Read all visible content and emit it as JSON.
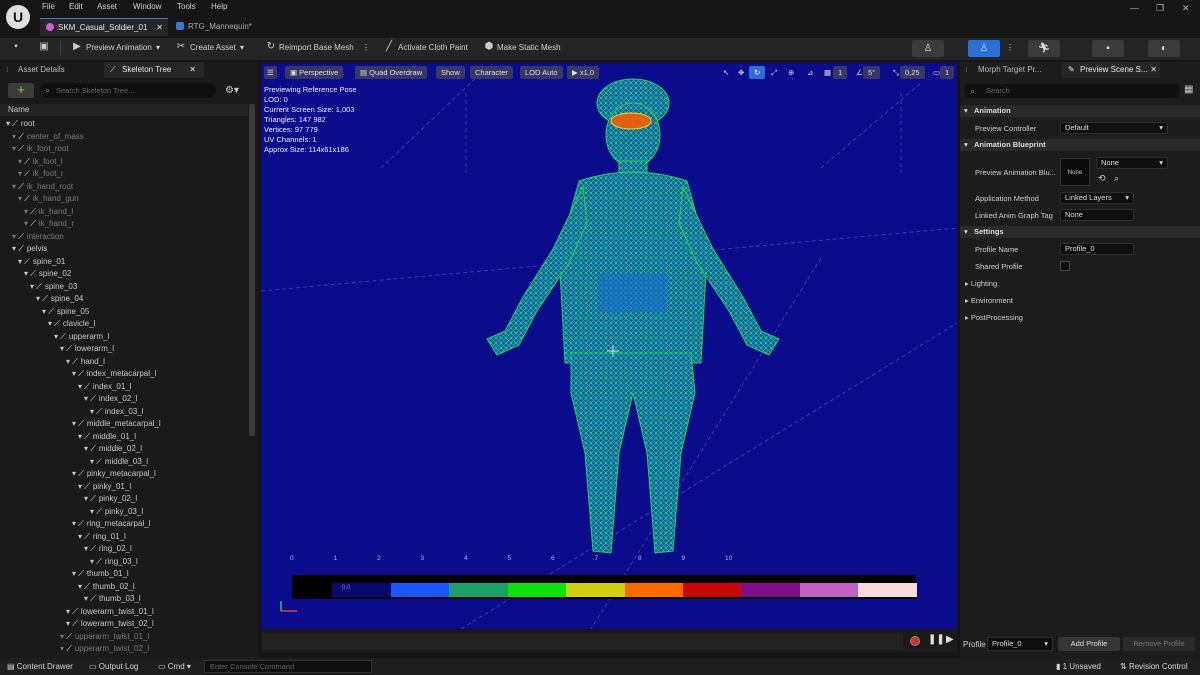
{
  "app": {
    "logo": "U",
    "menu": [
      "File",
      "Edit",
      "Asset",
      "Window",
      "Tools",
      "Help"
    ],
    "tabs": [
      "SKM_Casual_Soldier_01",
      "RTG_Mannequin*"
    ]
  },
  "toolbar": {
    "save_icon": "save-icon",
    "preview_animation": "Preview Animation",
    "create_asset": "Create Asset",
    "reimport": "Reimport Base Mesh",
    "activate_cloth": "Activate Cloth Paint",
    "make_static": "Make Static Mesh"
  },
  "left": {
    "tab_details": "Asset Details",
    "tab_skeleton": "Skeleton Tree",
    "search_placeholder": "Search Skeleton Tree...",
    "name_header": "Name",
    "tree": [
      {
        "label": "root",
        "depth": 0,
        "dim": false
      },
      {
        "label": "center_of_mass",
        "depth": 1,
        "dim": true
      },
      {
        "label": "ik_foot_root",
        "depth": 1,
        "dim": true
      },
      {
        "label": "ik_foot_l",
        "depth": 2,
        "dim": true
      },
      {
        "label": "ik_foot_r",
        "depth": 2,
        "dim": true
      },
      {
        "label": "ik_hand_root",
        "depth": 1,
        "dim": true
      },
      {
        "label": "ik_hand_gun",
        "depth": 2,
        "dim": true
      },
      {
        "label": "ik_hand_l",
        "depth": 3,
        "dim": true
      },
      {
        "label": "ik_hand_r",
        "depth": 3,
        "dim": true
      },
      {
        "label": "interaction",
        "depth": 1,
        "dim": true
      },
      {
        "label": "pelvis",
        "depth": 1,
        "dim": false
      },
      {
        "label": "spine_01",
        "depth": 2,
        "dim": false
      },
      {
        "label": "spine_02",
        "depth": 3,
        "dim": false
      },
      {
        "label": "spine_03",
        "depth": 4,
        "dim": false
      },
      {
        "label": "spine_04",
        "depth": 5,
        "dim": false
      },
      {
        "label": "spine_05",
        "depth": 6,
        "dim": false
      },
      {
        "label": "clavicle_l",
        "depth": 7,
        "dim": false
      },
      {
        "label": "upperarm_l",
        "depth": 8,
        "dim": false
      },
      {
        "label": "lowerarm_l",
        "depth": 9,
        "dim": false
      },
      {
        "label": "hand_l",
        "depth": 10,
        "dim": false
      },
      {
        "label": "index_metacarpal_l",
        "depth": 11,
        "dim": false
      },
      {
        "label": "index_01_l",
        "depth": 12,
        "dim": false
      },
      {
        "label": "index_02_l",
        "depth": 13,
        "dim": false
      },
      {
        "label": "index_03_l",
        "depth": 14,
        "dim": false
      },
      {
        "label": "middle_metacarpal_l",
        "depth": 11,
        "dim": false
      },
      {
        "label": "middle_01_l",
        "depth": 12,
        "dim": false
      },
      {
        "label": "middle_02_l",
        "depth": 13,
        "dim": false
      },
      {
        "label": "middle_03_l",
        "depth": 14,
        "dim": false
      },
      {
        "label": "pinky_metacarpal_l",
        "depth": 11,
        "dim": false
      },
      {
        "label": "pinky_01_l",
        "depth": 12,
        "dim": false
      },
      {
        "label": "pinky_02_l",
        "depth": 13,
        "dim": false
      },
      {
        "label": "pinky_03_l",
        "depth": 14,
        "dim": false
      },
      {
        "label": "ring_metacarpal_l",
        "depth": 11,
        "dim": false
      },
      {
        "label": "ring_01_l",
        "depth": 12,
        "dim": false
      },
      {
        "label": "ring_02_l",
        "depth": 13,
        "dim": false
      },
      {
        "label": "ring_03_l",
        "depth": 14,
        "dim": false
      },
      {
        "label": "thumb_01_l",
        "depth": 11,
        "dim": false
      },
      {
        "label": "thumb_02_l",
        "depth": 12,
        "dim": false
      },
      {
        "label": "thumb_03_l",
        "depth": 13,
        "dim": false
      },
      {
        "label": "lowerarm_twist_01_l",
        "depth": 10,
        "dim": false
      },
      {
        "label": "lowerarm_twist_02_l",
        "depth": 10,
        "dim": false
      },
      {
        "label": "upperarm_twist_01_l",
        "depth": 9,
        "dim": true
      },
      {
        "label": "upperarm_twist_02_l",
        "depth": 9,
        "dim": true
      }
    ]
  },
  "viewport": {
    "perspective": "Perspective",
    "view_mode": "Quad Overdraw",
    "show": "Show",
    "character": "Character",
    "lod": "LOD Auto",
    "play_rate": "x1,0",
    "stats": [
      "Previewing Reference Pose",
      "LOD: 0",
      "Current Screen Size: 1,003",
      "Triangles: 147 982",
      "Vertices: 97 779",
      "UV Channels: 1",
      "Approx Size: 114x61x186"
    ],
    "right_tools": {
      "grid_count": "1",
      "angle": "5°",
      "scale": "0,25",
      "camera": "1"
    },
    "legend_numbers": [
      "0",
      "1",
      "2",
      "3",
      "4",
      "5",
      "6",
      "7",
      "8",
      "9",
      "10"
    ],
    "legend_colors": [
      "#050a6e",
      "#1a55ff",
      "#1ba06a",
      "#10e010",
      "#d0d010",
      "#ff6a00",
      "#c80808",
      "#80108a",
      "#c060c0",
      "#f8dada"
    ],
    "legend_label": "0.0"
  },
  "right": {
    "tab_morph": "Morph Target Pr...",
    "tab_scene": "Preview Scene S...",
    "search_placeholder": "Search",
    "sections": {
      "animation": "Animation",
      "blueprint": "Animation Blueprint",
      "settings": "Settings"
    },
    "props": {
      "preview_controller": "Preview Controller",
      "preview_controller_value": "Default",
      "preview_anim_bp": "Preview Animation Blu...",
      "thumb_none": "None",
      "anim_bp_value": "None",
      "application_method": "Application Method",
      "application_method_value": "Linked Layers",
      "linked_tag": "Linked Anim Graph Tag",
      "linked_tag_value": "None",
      "profile_name": "Profile Name",
      "profile_name_value": "Profile_0",
      "shared_profile": "Shared Profile"
    },
    "subsections": [
      "Lighting",
      "Environment",
      "PostProcessing"
    ],
    "profile_label": "Profile",
    "profile_value": "Profile_0",
    "add_profile": "Add Profile",
    "remove_profile": "Remove Profile"
  },
  "status": {
    "content_drawer": "Content Drawer",
    "output_log": "Output Log",
    "cmd": "Cmd",
    "console_placeholder": "Enter Console Command",
    "unsaved": "1 Unsaved",
    "revision": "Revision Control"
  }
}
